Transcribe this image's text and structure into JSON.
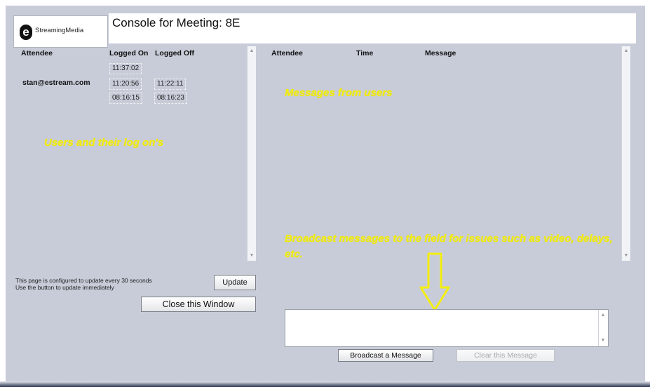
{
  "header": {
    "logo_mark": "e",
    "logo_text": "StreamingMedia",
    "title": "Console for Meeting: 8E"
  },
  "attendees": {
    "columns": [
      "Attendee",
      "Logged On",
      "Logged Off"
    ],
    "rows": [
      {
        "attendee": "",
        "logged_on": "11:37:02",
        "logged_off": ""
      },
      {
        "attendee": "stan@estream.com",
        "logged_on": "11:20:56",
        "logged_off": "11:22:11"
      },
      {
        "attendee": "",
        "logged_on": "08:16:15",
        "logged_off": "08:16:23"
      }
    ],
    "annotation": "Users and their log on's"
  },
  "messages": {
    "columns": [
      "Attendee",
      "Time",
      "Message"
    ],
    "annotation_top": "Messages from users",
    "annotation_bottom": "Broadcast messages to the field for issues such as video, delays, etc."
  },
  "footer": {
    "info_line1": "This page is configured to update every 30 seconds",
    "info_line2": "Use the button to update immediately",
    "update_label": "Update",
    "close_label": "Close this Window",
    "broadcast_label": "Broadcast a Message",
    "clear_label": "Clear this Message",
    "broadcast_value": ""
  },
  "colors": {
    "background": "#c8ccd8",
    "annotation": "#f4ee10"
  },
  "icons": {
    "scroll_up": "scroll-up-icon",
    "scroll_down": "scroll-down-icon",
    "arrow": "down-arrow-icon"
  }
}
